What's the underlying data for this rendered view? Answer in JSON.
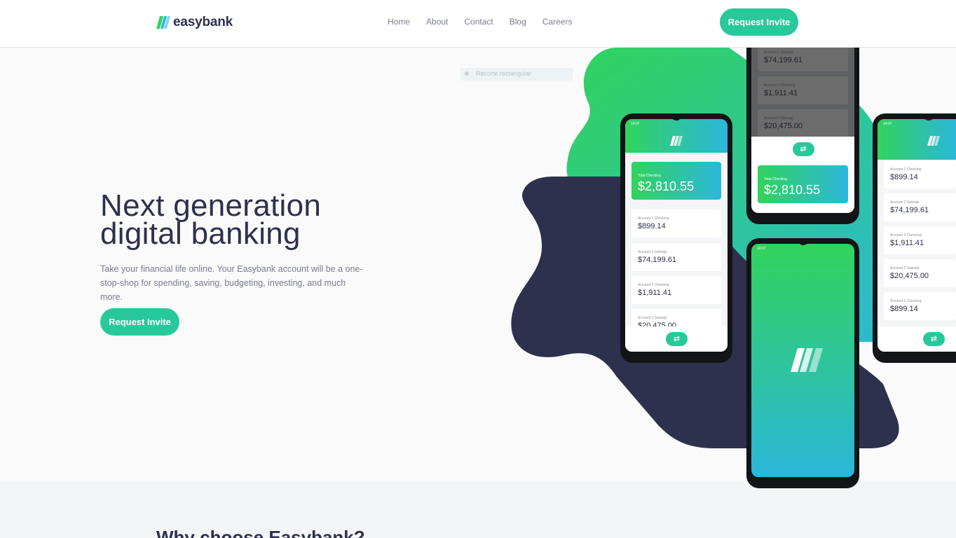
{
  "header": {
    "logo_text": "easybank",
    "nav": [
      "Home",
      "About",
      "Contact",
      "Blog",
      "Careers"
    ],
    "cta_label": "Request Invite"
  },
  "hero": {
    "title": "Next generation digital banking",
    "text": "Take your financial life online. Your Easybank account will be a one-stop-shop for spending, saving, budgeting, investing, and much more.",
    "cta_label": "Request Invite"
  },
  "overlay_text": "Recorte rectangular",
  "phones": {
    "time": "14:07",
    "total_label": "Total Checking",
    "total_amount": "$2,810.55",
    "accounts": [
      {
        "label": "Account 1 Checking",
        "amount": "$899.14"
      },
      {
        "label": "Account 2 Savings",
        "amount": "$74,199.61"
      },
      {
        "label": "Account 2 Checking",
        "amount": "$1,911.41"
      },
      {
        "label": "Account 2 Savings",
        "amount": "$20,475.00"
      },
      {
        "label": "Account 1 Checking",
        "amount": "$899.14"
      }
    ],
    "fab_symbol": "⇄"
  },
  "section": {
    "why_title": "Why choose Easybank?"
  },
  "colors": {
    "brand_green": "#31d35c",
    "brand_cyan": "#2bb7da",
    "navy": "#2d314d",
    "button": "#27c99a"
  }
}
